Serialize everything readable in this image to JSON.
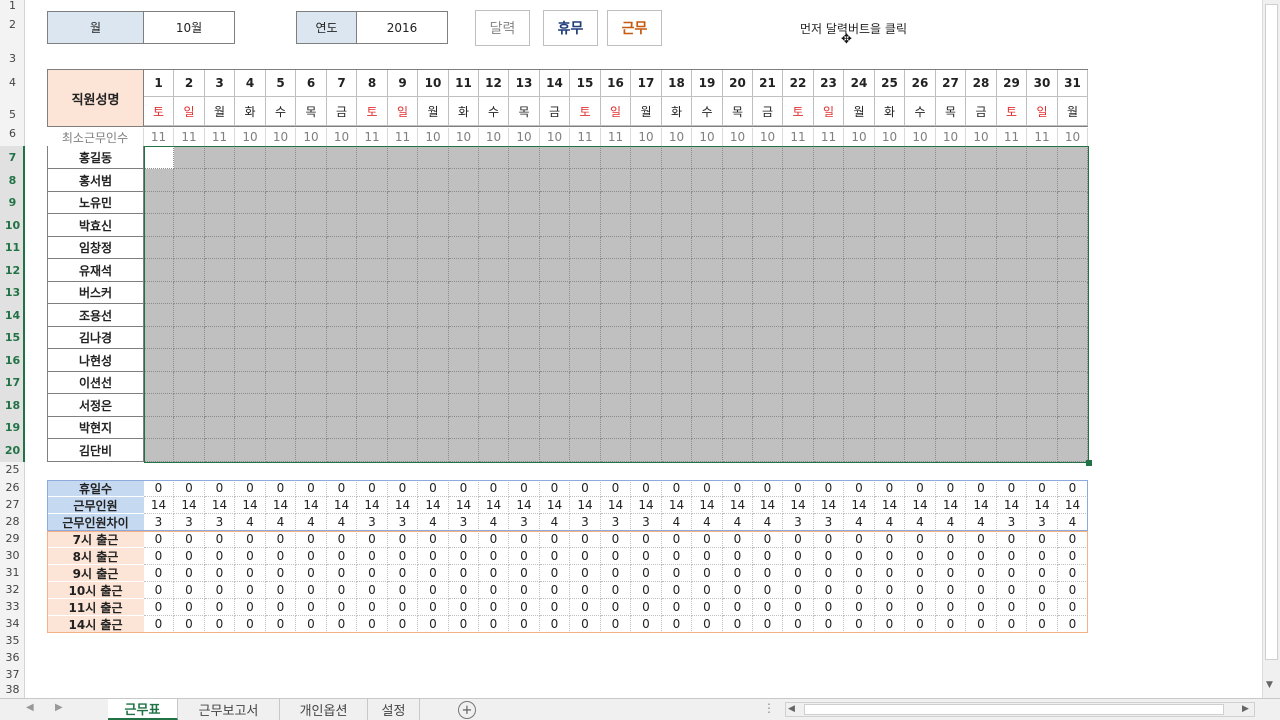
{
  "header": {
    "month_label": "월",
    "month_value": "10월",
    "year_label": "연도",
    "year_value": "2016",
    "btn_calendar": "달력",
    "btn_holiday": "휴무",
    "btn_work": "근무",
    "instruction": "먼저 달력버트을 클릭"
  },
  "row_numbers": [
    "1",
    "2",
    "3",
    "4",
    "5",
    "6",
    "7",
    "8",
    "9",
    "10",
    "11",
    "12",
    "13",
    "14",
    "15",
    "16",
    "17",
    "18",
    "19",
    "20",
    "25",
    "26",
    "27",
    "28",
    "29",
    "30",
    "31",
    "32",
    "33",
    "34",
    "35",
    "36",
    "37",
    "38"
  ],
  "table": {
    "name_header": "직원성명",
    "min_label": "최소근무인수",
    "days": [
      "1",
      "2",
      "3",
      "4",
      "5",
      "6",
      "7",
      "8",
      "9",
      "10",
      "11",
      "12",
      "13",
      "14",
      "15",
      "16",
      "17",
      "18",
      "19",
      "20",
      "21",
      "22",
      "23",
      "24",
      "25",
      "26",
      "27",
      "28",
      "29",
      "30",
      "31"
    ],
    "weekdays": [
      "토",
      "일",
      "월",
      "화",
      "수",
      "목",
      "금",
      "토",
      "일",
      "월",
      "화",
      "수",
      "목",
      "금",
      "토",
      "일",
      "월",
      "화",
      "수",
      "목",
      "금",
      "토",
      "일",
      "월",
      "화",
      "수",
      "목",
      "금",
      "토",
      "일",
      "월"
    ],
    "weekday_red": [
      true,
      true,
      false,
      false,
      false,
      false,
      false,
      true,
      true,
      false,
      false,
      false,
      false,
      false,
      true,
      true,
      false,
      false,
      false,
      false,
      false,
      true,
      true,
      false,
      false,
      false,
      false,
      false,
      true,
      true,
      false
    ],
    "min_counts": [
      "11",
      "11",
      "11",
      "10",
      "10",
      "10",
      "10",
      "11",
      "11",
      "10",
      "10",
      "10",
      "10",
      "10",
      "11",
      "11",
      "10",
      "10",
      "10",
      "10",
      "10",
      "11",
      "11",
      "10",
      "10",
      "10",
      "10",
      "10",
      "11",
      "11",
      "10"
    ],
    "employees": [
      "홍길동",
      "홍서범",
      "노유민",
      "박효신",
      "임창정",
      "유재석",
      "버스커",
      "조용선",
      "김나경",
      "나현성",
      "이션선",
      "서정은",
      "박현지",
      "김단비"
    ]
  },
  "summary": {
    "rows": [
      {
        "label": "휴일수",
        "values": [
          "0",
          "0",
          "0",
          "0",
          "0",
          "0",
          "0",
          "0",
          "0",
          "0",
          "0",
          "0",
          "0",
          "0",
          "0",
          "0",
          "0",
          "0",
          "0",
          "0",
          "0",
          "0",
          "0",
          "0",
          "0",
          "0",
          "0",
          "0",
          "0",
          "0",
          "0"
        ],
        "group": "blue"
      },
      {
        "label": "근무인원",
        "values": [
          "14",
          "14",
          "14",
          "14",
          "14",
          "14",
          "14",
          "14",
          "14",
          "14",
          "14",
          "14",
          "14",
          "14",
          "14",
          "14",
          "14",
          "14",
          "14",
          "14",
          "14",
          "14",
          "14",
          "14",
          "14",
          "14",
          "14",
          "14",
          "14",
          "14",
          "14"
        ],
        "group": "blue"
      },
      {
        "label": "근무인원차이",
        "values": [
          "3",
          "3",
          "3",
          "4",
          "4",
          "4",
          "4",
          "3",
          "3",
          "4",
          "3",
          "4",
          "3",
          "4",
          "3",
          "3",
          "3",
          "4",
          "4",
          "4",
          "4",
          "3",
          "3",
          "4",
          "4",
          "4",
          "4",
          "4",
          "3",
          "3",
          "4"
        ],
        "group": "blue"
      },
      {
        "label": "7시 출근",
        "values": [
          "0",
          "0",
          "0",
          "0",
          "0",
          "0",
          "0",
          "0",
          "0",
          "0",
          "0",
          "0",
          "0",
          "0",
          "0",
          "0",
          "0",
          "0",
          "0",
          "0",
          "0",
          "0",
          "0",
          "0",
          "0",
          "0",
          "0",
          "0",
          "0",
          "0",
          "0"
        ],
        "group": "orange"
      },
      {
        "label": "8시 출근",
        "values": [
          "0",
          "0",
          "0",
          "0",
          "0",
          "0",
          "0",
          "0",
          "0",
          "0",
          "0",
          "0",
          "0",
          "0",
          "0",
          "0",
          "0",
          "0",
          "0",
          "0",
          "0",
          "0",
          "0",
          "0",
          "0",
          "0",
          "0",
          "0",
          "0",
          "0",
          "0"
        ],
        "group": "orange"
      },
      {
        "label": "9시 출근",
        "values": [
          "0",
          "0",
          "0",
          "0",
          "0",
          "0",
          "0",
          "0",
          "0",
          "0",
          "0",
          "0",
          "0",
          "0",
          "0",
          "0",
          "0",
          "0",
          "0",
          "0",
          "0",
          "0",
          "0",
          "0",
          "0",
          "0",
          "0",
          "0",
          "0",
          "0",
          "0"
        ],
        "group": "orange"
      },
      {
        "label": "10시 출근",
        "values": [
          "0",
          "0",
          "0",
          "0",
          "0",
          "0",
          "0",
          "0",
          "0",
          "0",
          "0",
          "0",
          "0",
          "0",
          "0",
          "0",
          "0",
          "0",
          "0",
          "0",
          "0",
          "0",
          "0",
          "0",
          "0",
          "0",
          "0",
          "0",
          "0",
          "0",
          "0"
        ],
        "group": "orange"
      },
      {
        "label": "11시 출근",
        "values": [
          "0",
          "0",
          "0",
          "0",
          "0",
          "0",
          "0",
          "0",
          "0",
          "0",
          "0",
          "0",
          "0",
          "0",
          "0",
          "0",
          "0",
          "0",
          "0",
          "0",
          "0",
          "0",
          "0",
          "0",
          "0",
          "0",
          "0",
          "0",
          "0",
          "0",
          "0"
        ],
        "group": "orange"
      },
      {
        "label": "14시 출근",
        "values": [
          "0",
          "0",
          "0",
          "0",
          "0",
          "0",
          "0",
          "0",
          "0",
          "0",
          "0",
          "0",
          "0",
          "0",
          "0",
          "0",
          "0",
          "0",
          "0",
          "0",
          "0",
          "0",
          "0",
          "0",
          "0",
          "0",
          "0",
          "0",
          "0",
          "0",
          "0"
        ],
        "group": "orange"
      }
    ]
  },
  "tabs": [
    "근무표",
    "근무보고서",
    "개인옵션",
    "설정"
  ],
  "active_tab": 0,
  "colors": {
    "blue_header": "#dce6f1",
    "grid_gray": "#c0c0c0",
    "red_weekend": "#e03030",
    "excel_green": "#217346"
  }
}
